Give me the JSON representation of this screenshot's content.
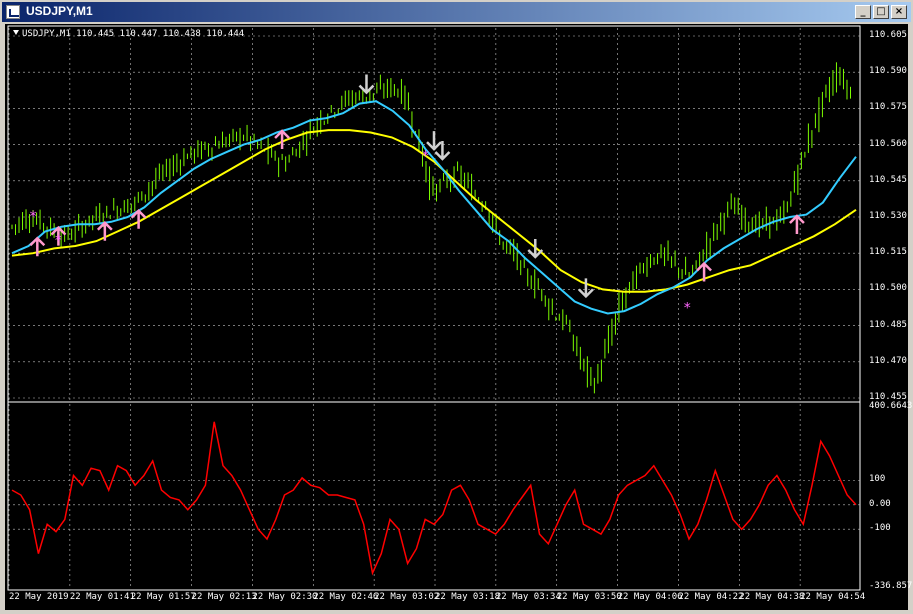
{
  "window": {
    "title": "USDJPY,M1",
    "info_line": "USDJPY,M1  110.445 110.447 110.438 110.444"
  },
  "colors": {
    "background": "#000000",
    "grid": "#c0c0c0",
    "bull_candle": "#7cfc00",
    "ma_fast": "#33ccff",
    "ma_slow": "#ffff00",
    "oscillator": "#ff0000",
    "buy_arrow": "#ff99cc",
    "sell_arrow": "#d0d0d0"
  },
  "price_axis": {
    "min": 110.455,
    "max": 110.605,
    "ticks": [
      "110.605",
      "110.590",
      "110.575",
      "110.560",
      "110.545",
      "110.530",
      "110.515",
      "110.500",
      "110.485",
      "110.470",
      "110.455"
    ]
  },
  "oscillator_axis": {
    "ticks": [
      "400.6643",
      "100",
      "0.00",
      "-100",
      "-336.857"
    ]
  },
  "time_axis": {
    "ticks": [
      "22 May 2019",
      "22 May 01:41",
      "22 May 01:57",
      "22 May 02:13",
      "22 May 02:30",
      "22 May 02:46",
      "22 May 03:02",
      "22 May 03:18",
      "22 May 03:34",
      "22 May 03:50",
      "22 May 04:06",
      "22 May 04:22",
      "22 May 04:38",
      "22 May 04:54"
    ]
  },
  "chart_data": {
    "type": "line",
    "title": "USDJPY,M1",
    "last_quote": {
      "open": 110.445,
      "high": 110.447,
      "low": 110.438,
      "close": 110.444
    },
    "price_close": [
      110.526,
      110.53,
      110.528,
      110.524,
      110.522,
      110.526,
      110.53,
      110.532,
      110.534,
      110.536,
      110.542,
      110.548,
      110.552,
      110.556,
      110.558,
      110.56,
      110.562,
      110.564,
      110.56,
      110.556,
      110.552,
      110.558,
      110.566,
      110.572,
      110.576,
      110.58,
      110.58,
      110.582,
      110.584,
      110.58,
      110.56,
      110.54,
      110.545,
      110.548,
      110.54,
      110.535,
      110.52,
      110.515,
      110.505,
      110.5,
      110.49,
      110.485,
      110.47,
      110.46,
      110.478,
      110.495,
      110.505,
      110.512,
      110.515,
      110.51,
      110.505,
      110.515,
      110.525,
      110.535,
      110.53,
      110.526,
      110.528,
      110.53,
      110.548,
      110.565,
      110.58,
      110.59,
      110.58
    ],
    "ma_fast": [
      110.515,
      110.518,
      110.524,
      110.526,
      110.527,
      110.527,
      110.528,
      110.53,
      110.534,
      110.54,
      110.545,
      110.55,
      110.554,
      110.557,
      110.56,
      110.562,
      110.565,
      110.567,
      110.57,
      110.571,
      110.573,
      110.577,
      110.578,
      110.574,
      110.568,
      110.558,
      110.55,
      110.541,
      110.533,
      110.525,
      110.52,
      110.513,
      110.507,
      110.501,
      110.495,
      110.492,
      110.49,
      110.491,
      110.494,
      110.498,
      110.501,
      110.505,
      110.512,
      110.517,
      110.521,
      110.525,
      110.528,
      110.53,
      110.531,
      110.536,
      110.546,
      110.555
    ],
    "ma_slow": [
      110.514,
      110.515,
      110.517,
      110.518,
      110.52,
      110.524,
      110.528,
      110.533,
      110.538,
      110.543,
      110.548,
      110.553,
      110.558,
      110.562,
      110.565,
      110.566,
      110.566,
      110.565,
      110.563,
      110.559,
      110.553,
      110.545,
      110.537,
      110.53,
      110.523,
      110.516,
      110.508,
      110.503,
      110.5,
      110.499,
      110.499,
      110.5,
      110.502,
      110.505,
      110.508,
      110.51,
      110.514,
      110.518,
      110.522,
      110.527,
      110.533
    ],
    "oscillator": [
      60,
      40,
      -20,
      -200,
      -80,
      -110,
      -60,
      120,
      80,
      150,
      140,
      60,
      160,
      140,
      80,
      120,
      180,
      60,
      30,
      20,
      -20,
      20,
      80,
      340,
      160,
      120,
      60,
      -20,
      -100,
      -140,
      -60,
      40,
      60,
      110,
      80,
      70,
      40,
      40,
      30,
      20,
      -80,
      -280,
      -200,
      -60,
      -100,
      -240,
      -180,
      -60,
      -80,
      -40,
      60,
      80,
      20,
      -80,
      -100,
      -120,
      -80,
      -20,
      30,
      80,
      -120,
      -160,
      -80,
      0,
      60,
      -80,
      -100,
      -120,
      -60,
      40,
      80,
      100,
      120,
      160,
      100,
      40,
      -40,
      -140,
      -80,
      20,
      140,
      40,
      -60,
      -100,
      -60,
      0,
      80,
      120,
      60,
      -20,
      -80,
      80,
      260,
      200,
      120,
      40,
      0
    ],
    "buy_arrows": 7,
    "sell_arrows": 5
  }
}
